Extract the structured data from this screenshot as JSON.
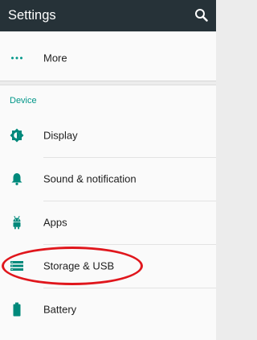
{
  "app_bar": {
    "title": "Settings",
    "background": "#263238",
    "search_icon": "search-icon"
  },
  "more_row": {
    "label": "More",
    "icon": "more-horiz-icon"
  },
  "section": {
    "header": "Device",
    "accent": "#009688",
    "items": [
      {
        "label": "Display",
        "icon": "brightness-icon"
      },
      {
        "label": "Sound & notification",
        "icon": "bell-icon"
      },
      {
        "label": "Apps",
        "icon": "android-icon"
      },
      {
        "label": "Storage & USB",
        "icon": "storage-icon",
        "highlighted": true
      },
      {
        "label": "Battery",
        "icon": "battery-icon"
      }
    ]
  },
  "highlight": {
    "color": "#e0161c",
    "target": "Storage & USB"
  }
}
